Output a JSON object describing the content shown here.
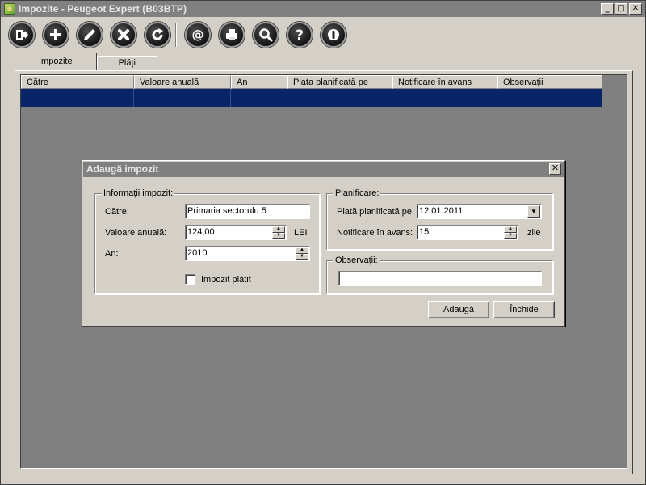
{
  "window": {
    "title": "Impozite - Peugeot Expert (B03BTP)",
    "minimize": "_",
    "maximize": "□",
    "close": "✕"
  },
  "toolbar": {
    "buttons": [
      {
        "icon": "exit-icon"
      },
      {
        "icon": "add-icon"
      },
      {
        "icon": "edit-icon"
      },
      {
        "icon": "delete-icon"
      },
      {
        "icon": "refresh-icon"
      },
      {
        "icon": "email-icon"
      },
      {
        "icon": "print-icon"
      },
      {
        "icon": "search-icon"
      },
      {
        "icon": "help-icon"
      },
      {
        "icon": "power-icon"
      }
    ]
  },
  "tabs": [
    {
      "label": "Impozite",
      "active": true
    },
    {
      "label": "Plăți",
      "active": false
    }
  ],
  "grid": {
    "columns": [
      "Către",
      "Valoare anuală",
      "An",
      "Plata planificată pe",
      "Notificare în avans",
      "Observații"
    ],
    "selection_color": "#0a246a"
  },
  "dialog": {
    "title": "Adaugă impozit",
    "close": "✕",
    "info_group": {
      "legend": "Informații impozit:",
      "catre_label": "Către:",
      "catre_value": "Primaria sectorulu 5",
      "valoare_label": "Valoare anuală:",
      "valoare_value": "124,00",
      "valoare_unit": "LEI",
      "an_label": "An:",
      "an_value": "2010",
      "platit_label": "Impozit plătit",
      "platit_checked": false
    },
    "plan_group": {
      "legend": "Planificare:",
      "plata_label": "Plată planificată pe:",
      "plata_value": "12.01.2011",
      "notif_label": "Notificare în avans:",
      "notif_value": "15",
      "notif_unit": "zile"
    },
    "obs_group": {
      "legend": "Observații:",
      "value": ""
    },
    "add_button": "Adaugă",
    "close_button": "Închide"
  }
}
